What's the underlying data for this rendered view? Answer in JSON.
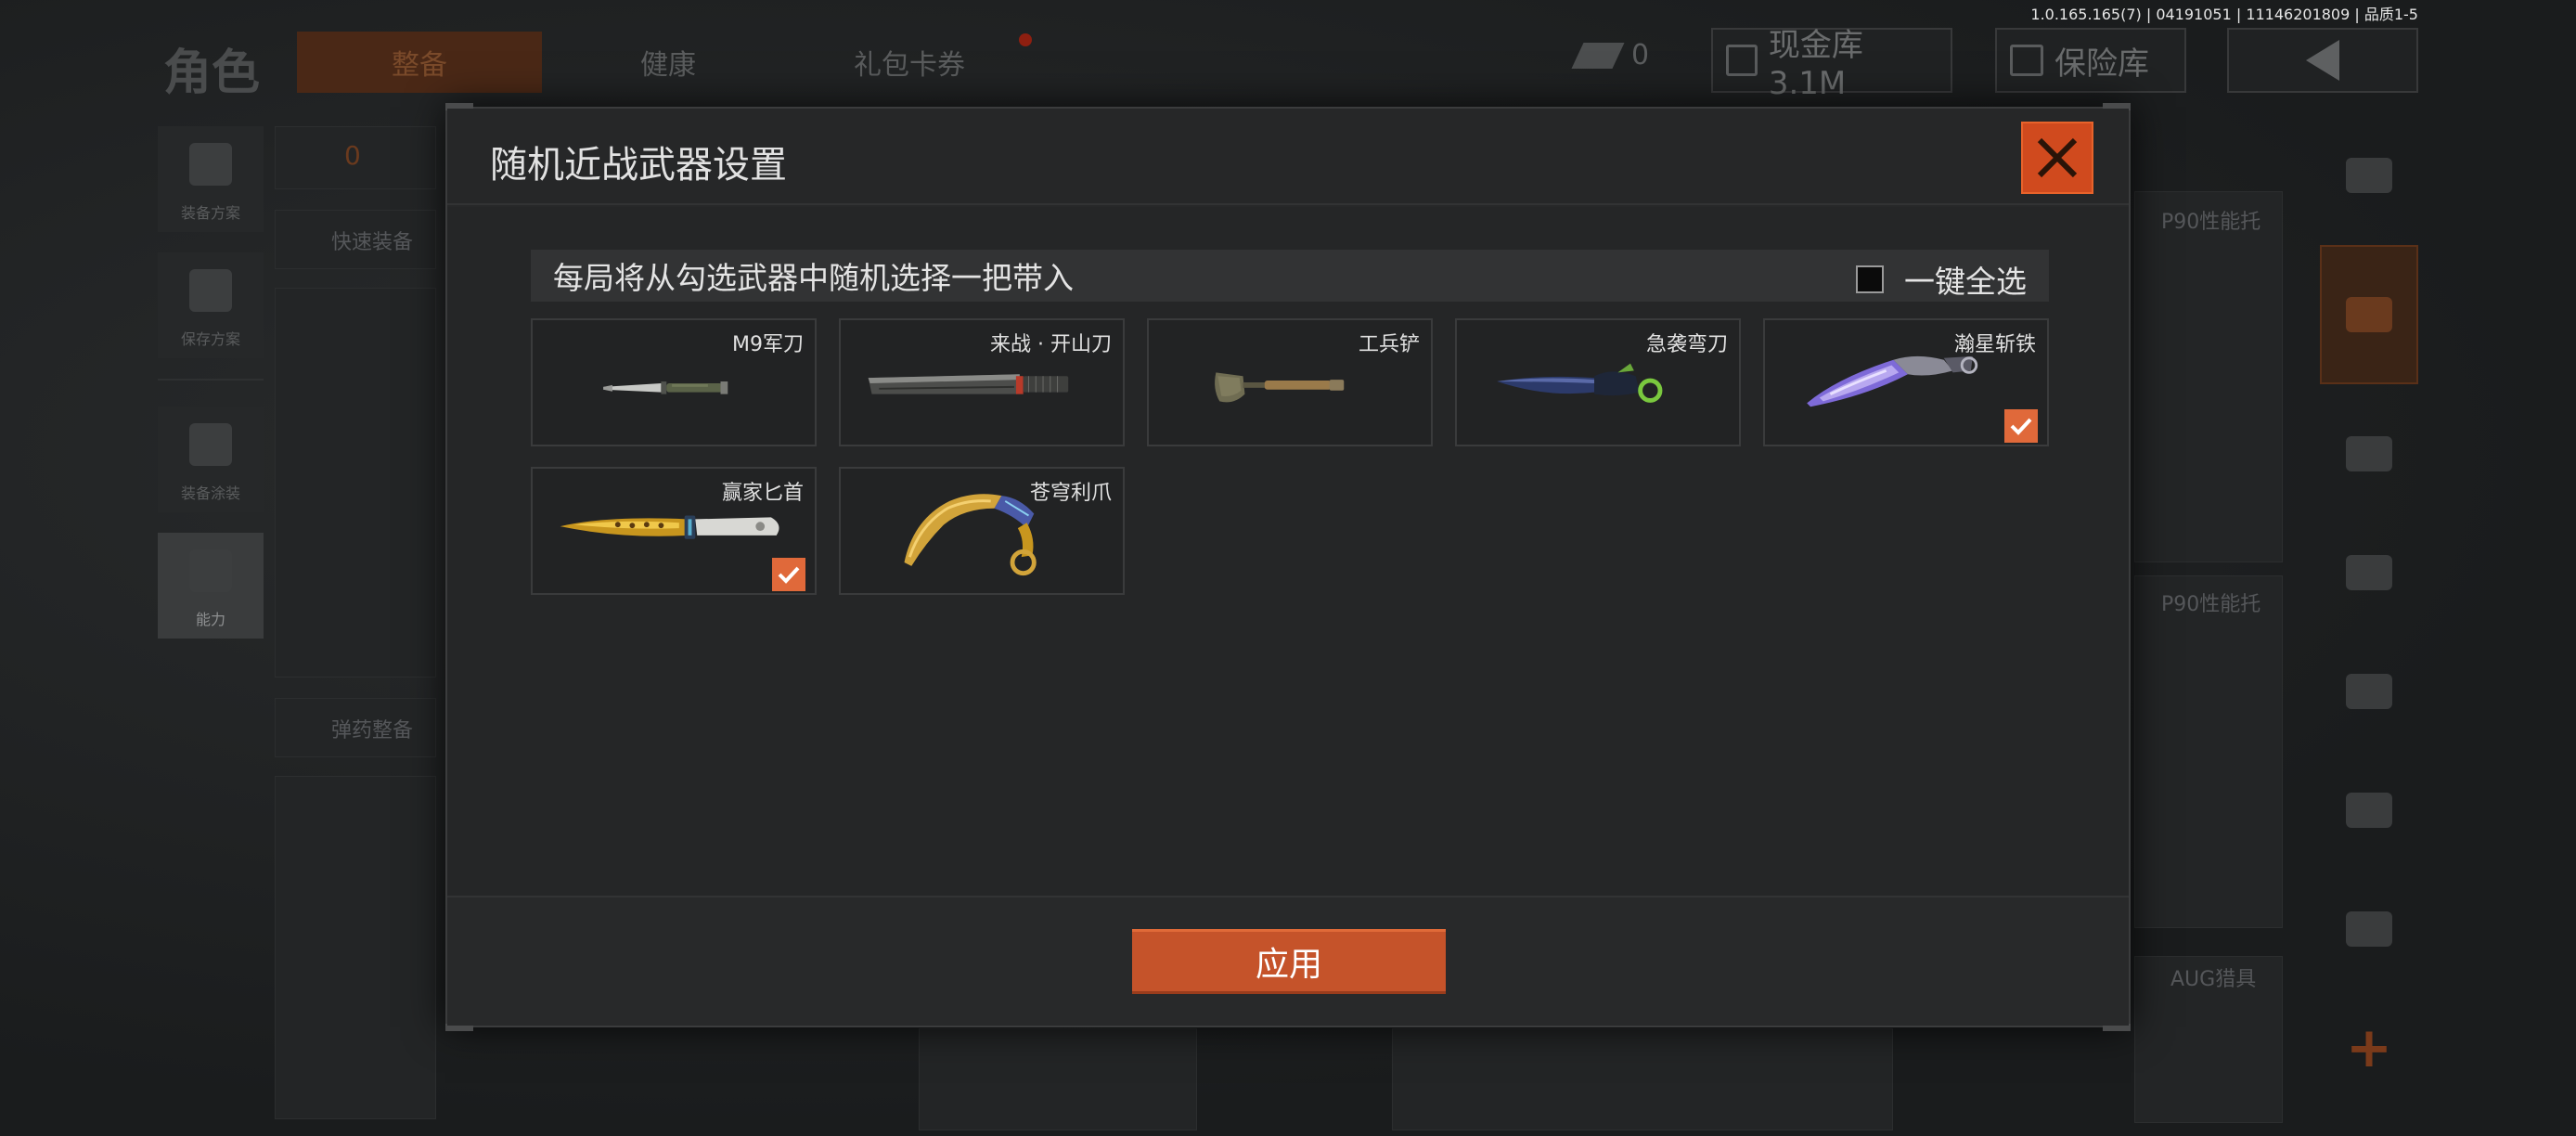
{
  "version": "1.0.165.165(7) | 04191051 | 11146201809 | 品质1-5",
  "background": {
    "title": "角色",
    "tabs": [
      {
        "label": "整备",
        "active": true
      },
      {
        "label": "健康",
        "active": false
      },
      {
        "label": "礼包卡券",
        "active": false
      }
    ],
    "currency_count": "0",
    "cash_storage": "现金库 3.1M",
    "vault": "保险库",
    "left_menu": [
      {
        "label": "装备方案"
      },
      {
        "label": "保存方案"
      },
      {
        "label": "装备涂装"
      },
      {
        "label": "能力"
      }
    ],
    "armor_count": "0",
    "help": "?",
    "quick_equip": "快速装备",
    "ammo": "弹药整备",
    "side_labels": [
      "P90性能托",
      "P90性能托",
      "AUG猎具"
    ]
  },
  "modal": {
    "title": "随机近战武器设置",
    "info": "每局将从勾选武器中随机选择一把带入",
    "select_all_label": "一键全选",
    "select_all_checked": false,
    "weapons": [
      {
        "name": "M9军刀",
        "checked": false,
        "icon": "bayonet-knife-icon"
      },
      {
        "name": "来战 · 开山刀",
        "checked": false,
        "icon": "machete-icon"
      },
      {
        "name": "工兵铲",
        "checked": false,
        "icon": "shovel-icon"
      },
      {
        "name": "急袭弯刀",
        "checked": false,
        "icon": "curved-blade-icon"
      },
      {
        "name": "瀚星斩铁",
        "checked": true,
        "icon": "purple-blade-icon"
      },
      {
        "name": "赢家匕首",
        "checked": true,
        "icon": "gold-dagger-icon"
      },
      {
        "name": "苍穹利爪",
        "checked": false,
        "icon": "karambit-icon"
      }
    ],
    "apply_label": "应用"
  },
  "colors": {
    "accent": "#d04a1e",
    "check": "#e0693a",
    "apply": "#c5532a"
  }
}
